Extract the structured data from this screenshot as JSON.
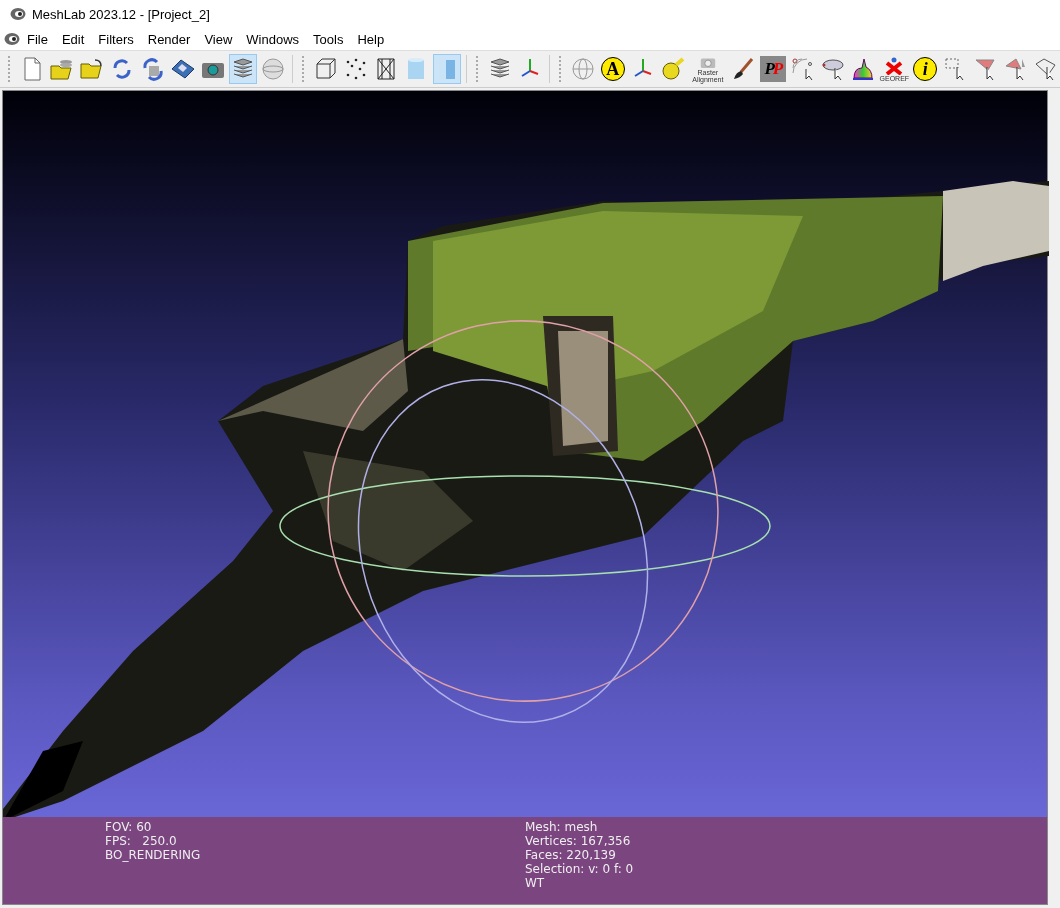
{
  "window": {
    "title": "MeshLab 2023.12 - [Project_2]"
  },
  "menu": [
    "File",
    "Edit",
    "Filters",
    "Render",
    "View",
    "Windows",
    "Tools",
    "Help"
  ],
  "toolbar_groups": [
    [
      {
        "kind": "page",
        "selected": false
      },
      {
        "kind": "folder-stack",
        "selected": false
      },
      {
        "kind": "folder",
        "selected": false
      },
      {
        "kind": "reload",
        "selected": false
      },
      {
        "kind": "reload-stack",
        "selected": false
      },
      {
        "kind": "floppy",
        "selected": false
      },
      {
        "kind": "camera",
        "selected": false
      },
      {
        "kind": "layers",
        "selected": true
      },
      {
        "kind": "sphere",
        "selected": false
      }
    ],
    [
      {
        "kind": "cube",
        "selected": false
      },
      {
        "kind": "dots",
        "selected": false
      },
      {
        "kind": "wire",
        "selected": false
      },
      {
        "kind": "cylinder",
        "selected": false
      },
      {
        "kind": "cylinder-flat",
        "selected": true
      }
    ],
    [
      {
        "kind": "layers",
        "selected": false
      },
      {
        "kind": "axes",
        "selected": false
      }
    ],
    [
      {
        "kind": "globe",
        "selected": false
      },
      {
        "kind": "letter",
        "label": "A",
        "selected": false
      },
      {
        "kind": "axes",
        "selected": false
      },
      {
        "kind": "tape",
        "selected": false
      },
      {
        "kind": "camera-caption",
        "label": "Raster Alignment",
        "selected": false
      },
      {
        "kind": "brush",
        "selected": false
      },
      {
        "kind": "pp",
        "label": "PP",
        "selected": false
      },
      {
        "kind": "point-pick",
        "selected": false
      },
      {
        "kind": "ellipse-pick",
        "selected": false
      },
      {
        "kind": "bunny",
        "selected": false
      },
      {
        "kind": "georef",
        "label": "GEOREF",
        "selected": false
      },
      {
        "kind": "letter",
        "label": "i",
        "selected": false
      },
      {
        "kind": "rect-select",
        "selected": false
      },
      {
        "kind": "face-select",
        "selected": false
      },
      {
        "kind": "face-select-2",
        "selected": false
      },
      {
        "kind": "outline-select",
        "selected": false
      }
    ]
  ],
  "info_panel": {
    "left": [
      "FOV: 60",
      "FPS:   250.0",
      "BO_RENDERING"
    ],
    "right": [
      "Mesh: mesh",
      "Vertices: 167,356",
      "Faces: 220,139",
      "Selection: v: 0 f: 0",
      "WT"
    ]
  }
}
